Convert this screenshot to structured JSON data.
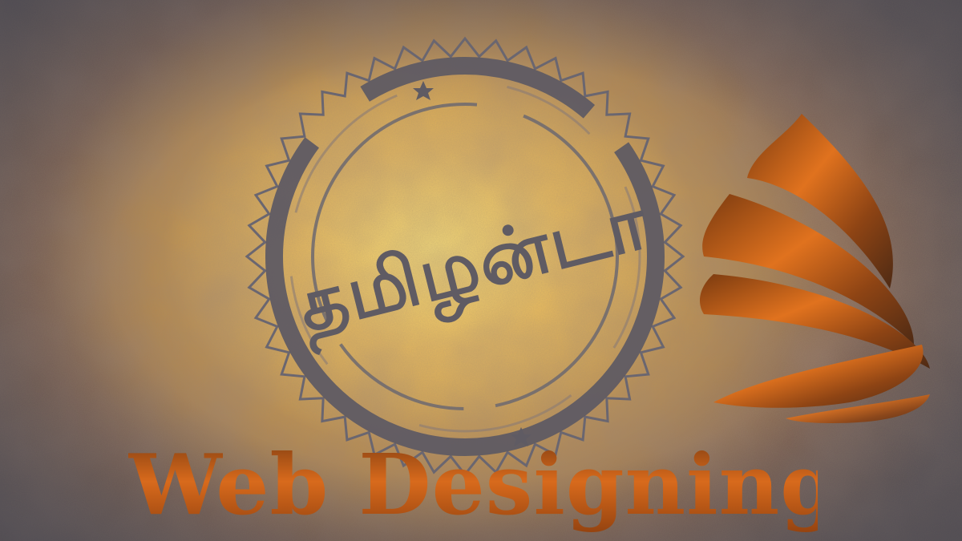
{
  "logo": {
    "tamil_wordmark": "தமிழன்டா"
  },
  "headline": {
    "text": "Web Designing"
  },
  "colors": {
    "stamp_gray": "#5f5b63",
    "glow_yellow": "#ffe478",
    "brand_orange": "#d86a1c",
    "brand_brown": "#7a3a10"
  }
}
